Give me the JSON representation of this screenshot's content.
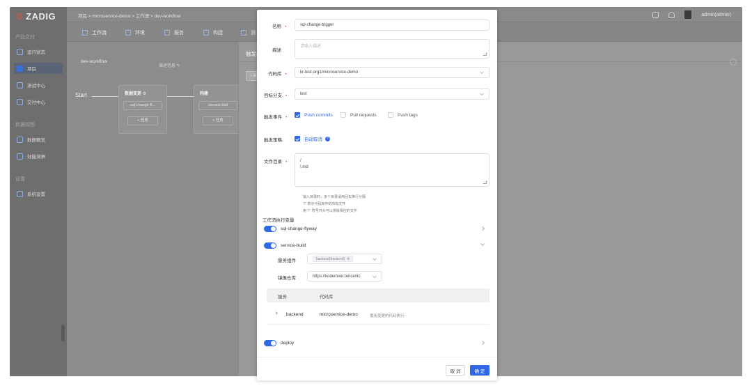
{
  "app": {
    "logo": "ZADIG"
  },
  "sidebar": {
    "sections": [
      {
        "title": "产品交付"
      },
      {
        "title": "数据视图"
      },
      {
        "title": "设置"
      }
    ],
    "items": [
      {
        "label": "运行状态",
        "icon": "monitor-icon"
      },
      {
        "label": "项目",
        "icon": "project-icon",
        "active": true
      },
      {
        "label": "测试中心",
        "icon": "test-icon"
      },
      {
        "label": "交付中心",
        "icon": "delivery-icon"
      },
      {
        "label": "数据概览",
        "icon": "overview-icon"
      },
      {
        "label": "效能洞察",
        "icon": "insight-icon"
      },
      {
        "label": "系统设置",
        "icon": "settings-icon"
      }
    ]
  },
  "topbar": {
    "breadcrumb": "项目 > microservice-demo > 工作流 > dev-workflow",
    "user": "admin(admin)"
  },
  "tabs": [
    {
      "label": "工作流",
      "active": true
    },
    {
      "label": "环境"
    },
    {
      "label": "服务"
    },
    {
      "label": "构建"
    },
    {
      "label": "测"
    }
  ],
  "workflow": {
    "name": "dev-workflow",
    "desc_hint": "描述信息",
    "start": "Start",
    "stages": [
      {
        "title": "数据变更",
        "job": "sql-change-fl...",
        "add": "+ 任务"
      },
      {
        "title": "构建",
        "job": "service-buil",
        "add": "+ 任务"
      }
    ]
  },
  "drawer": {
    "title": "触发器",
    "add_button": "+ 添加"
  },
  "modal": {
    "name_label": "名称",
    "name_value": "sql-change-trigger",
    "desc_label": "描述",
    "desc_placeholder": "请输入描述",
    "repo_label": "代码库",
    "repo_value": "kr-test-org1/microservice-demo",
    "branch_label": "目标分支",
    "branch_value": "test",
    "event_label": "触发事件",
    "events": [
      {
        "label": "Push commits",
        "checked": true
      },
      {
        "label": "Pull requests",
        "checked": false
      },
      {
        "label": "Push tags",
        "checked": false
      }
    ],
    "strategy_label": "触发策略",
    "strategy_option": "自动取消",
    "dir_label": "文件目录",
    "dir_lines": [
      "/",
      "!.md"
    ],
    "hints": [
      "输入目录时，多个目录请用回车换行分隔",
      "\"/\" 表示代码库中的所有文件",
      "用 \"!\" 符号开头可以排除相应的文件"
    ],
    "vars_title": "工作流执行变量",
    "jobs": [
      {
        "name": "sql-change-flyway",
        "enabled": true,
        "expanded": false
      },
      {
        "name": "service-build",
        "enabled": true,
        "expanded": true
      },
      {
        "name": "deploy",
        "enabled": true,
        "expanded": false
      }
    ],
    "service_label": "服务组件",
    "service_tag": "backend(backend)",
    "registry_label": "镜像仓库",
    "registry_value": "https://koderover.tencentc",
    "table": {
      "headers": [
        "服务",
        "代码库"
      ],
      "rows": [
        {
          "service": "backend",
          "repo": "microservice-demo",
          "note": "使用变更的代码执行"
        }
      ]
    },
    "cancel": "取 消",
    "ok": "确 定"
  },
  "colors": {
    "primary": "#3067e4",
    "required": "#e05a45",
    "overlay": "#8c8c8c"
  }
}
